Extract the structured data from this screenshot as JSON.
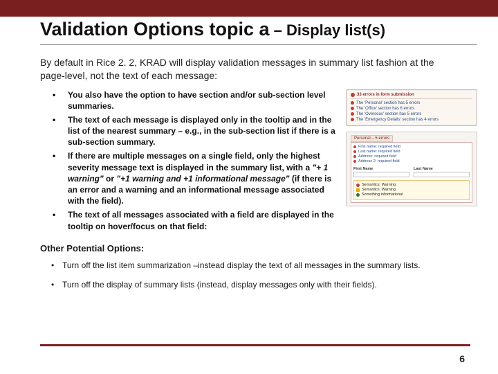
{
  "title_main": "Validation Options topic a",
  "title_sep": " – ",
  "title_sub": "Display list(s)",
  "intro": "By default in Rice 2. 2, KRAD will display validation messages in summary list fashion at the page-level, not the text of each message:",
  "bullets": [
    "You also have the option to have section and/or sub-section level summaries.",
    "The text of each message is displayed only in the tooltip and in the list of the nearest summary – e.g., in the sub-section list if there is a sub-section summary.",
    "If there are multiple messages on a single field, only the highest severity message text is displayed in the summary list, with a \"+ 1 warning\" or \"+1 warning and +1 informational message\" (if there is an error and a warning and an informational message associated with the field).",
    "The text of all messages associated with a field are displayed in the tooltip on hover/focus on that field:"
  ],
  "other_heading": "Other Potential Options:",
  "other_items": [
    "Turn off the list item summarization –instead display the text of all messages in the summary lists.",
    "Turn off the display of summary lists  (instead, display messages only with their fields)."
  ],
  "page_number": "6",
  "thumb1": {
    "header": "33 errors in form submission",
    "items": [
      "The 'Personal' section has 5 errors",
      "The 'Office' section has 6 errors",
      "The 'Overseas' section has 5 errors",
      "The 'Emergency Details' section has 4 errors"
    ]
  },
  "thumb2": {
    "tab": "Personal – 5 errors",
    "items": [
      "First name: required field",
      "Last name: required field",
      "Address: required field",
      "Address 2: required field"
    ],
    "fields": {
      "a_label": "First Name",
      "b_label": "Last Name"
    },
    "tooltip": {
      "err": "Semantics: Warning",
      "warn": "Semantics: Warning",
      "info": "Something informational"
    }
  }
}
